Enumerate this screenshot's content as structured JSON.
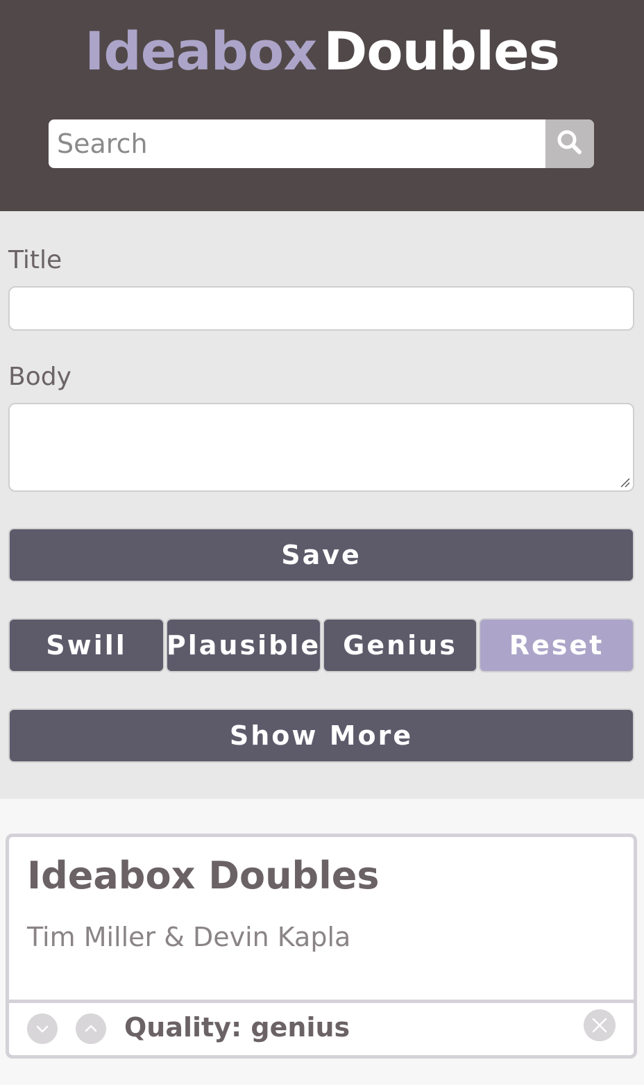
{
  "header": {
    "brand_part1": "Ideabox",
    "brand_part2": "Doubles",
    "search_placeholder": "Search",
    "search_value": "",
    "search_icon": "search-icon"
  },
  "form": {
    "title_label": "Title",
    "title_value": "",
    "body_label": "Body",
    "body_value": "",
    "save_label": "Save"
  },
  "filters": {
    "swill_label": "Swill",
    "plausible_label": "Plausible",
    "genius_label": "Genius",
    "reset_label": "Reset"
  },
  "show_more_label": "Show More",
  "ideas": [
    {
      "title": "Ideabox Doubles",
      "body": "Tim Miller & Devin Kapla",
      "quality_text": "Quality: genius",
      "downvote_icon": "chevron-down-icon",
      "upvote_icon": "chevron-up-icon",
      "delete_icon": "close-icon"
    }
  ],
  "colors": {
    "header_bg": "#514849",
    "accent": "#aca5c9",
    "button_bg": "#5d5a6a",
    "form_bg": "#e8e8e8"
  }
}
